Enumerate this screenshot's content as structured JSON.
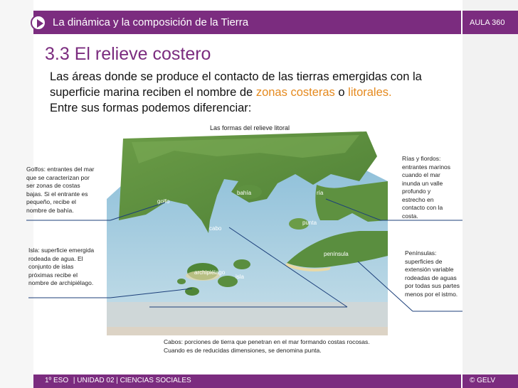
{
  "header": {
    "title": "La dinámica y la composición de la Tierra",
    "badge": "AULA 360"
  },
  "section": {
    "title": "3.3 El relieve costero"
  },
  "intro": {
    "part1": "Las áreas donde se produce el contacto de las tierras emergidas con la superficie marina reciben el nombre de ",
    "term1": "zonas costeras",
    "connector": " o ",
    "term2": "litorales.",
    "line3": "Entre sus formas podemos diferenciar:"
  },
  "figure": {
    "title": "Las formas del relieve litoral",
    "labels": {
      "golfo": "golfo",
      "bahia": "bahía",
      "ria": "ría",
      "punta": "punta",
      "cabo": "cabo",
      "peninsula": "península",
      "archipielago": "archipiélago",
      "isla": "isla"
    }
  },
  "annotations": {
    "golfos": "Golfos: entrantes del mar que se caracterizan por ser zonas de costas bajas. Si el entrante es pequeño, recibe el nombre de bahía.",
    "rias": "Rías y fiordos: entrantes marinos cuando el mar inunda un valle profundo y estrecho en contacto con la costa.",
    "isla": "Isla: superficie emergida rodeada de agua. El conjunto de islas próximas recibe el nombre de archipiélago.",
    "peninsulas": "Penínsulas: superficies de extensión variable rodeadas de aguas por todas sus partes menos por el istmo.",
    "cabos": "Cabos: porciones de tierra que penetran en el mar formando costas rocosas. Cuando es de reducidas dimensiones, se denomina punta."
  },
  "footer": {
    "course": "1º ESO",
    "unit": "| UNIDAD 02 | CIENCIAS SOCIALES",
    "copyright": "© GELV"
  },
  "colors": {
    "accent": "#7b2c7f",
    "highlight": "#e58a1f",
    "sea": "#7fb5d3",
    "land": "#5e9140"
  }
}
